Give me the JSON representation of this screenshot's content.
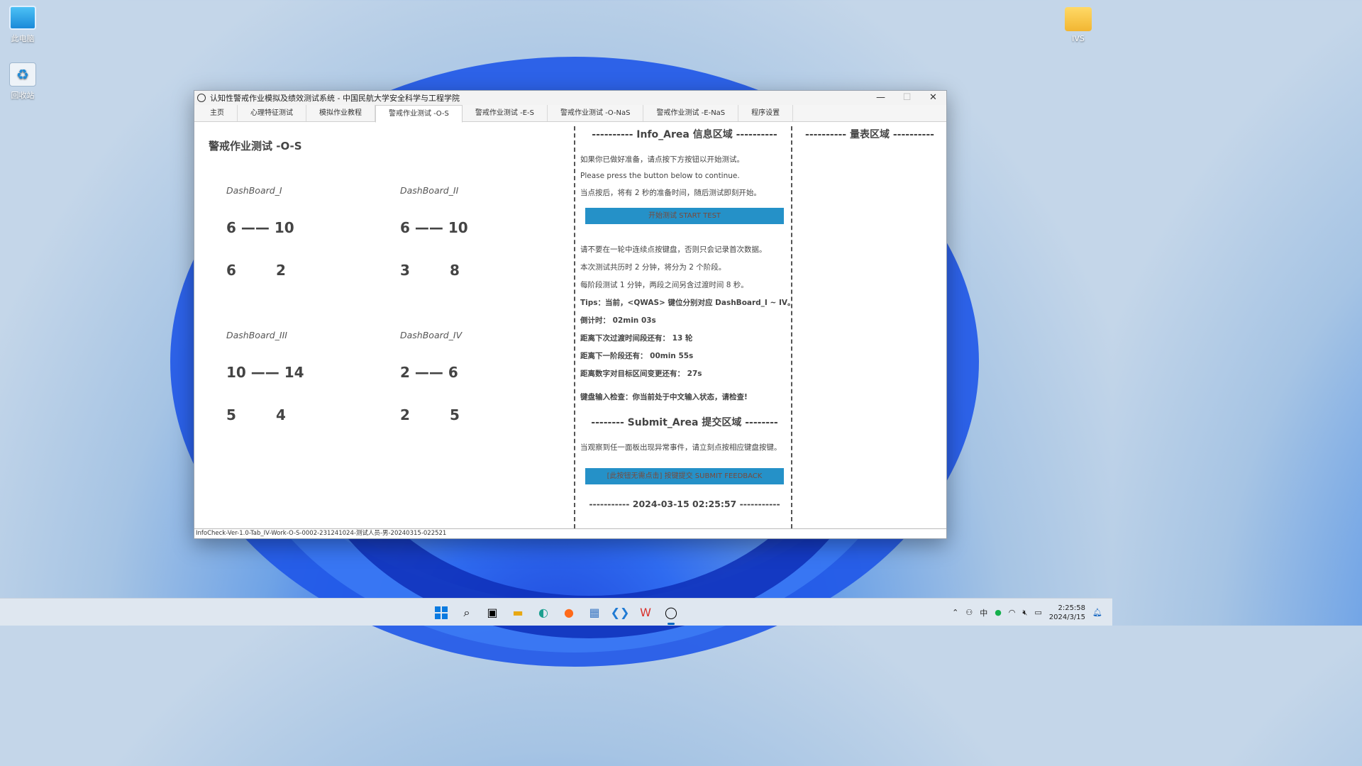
{
  "desktop": {
    "icons": [
      {
        "label": "此电脑"
      },
      {
        "label": "回收站"
      },
      {
        "label": "IVS"
      }
    ]
  },
  "window": {
    "title": "认知性警戒作业模拟及绩效测试系统 - 中国民航大学安全科学与工程学院",
    "controls": {
      "minimize": "—",
      "maximize": "☐",
      "close": "✕"
    }
  },
  "tabs": [
    {
      "label": "主页"
    },
    {
      "label": "心理特征测试"
    },
    {
      "label": "模拟作业教程"
    },
    {
      "label": "警戒作业测试 -O-S",
      "active": true
    },
    {
      "label": "警戒作业测试 -E-S"
    },
    {
      "label": "警戒作业测试 -O-NaS"
    },
    {
      "label": "警戒作业测试 -E-NaS"
    },
    {
      "label": "程序设置"
    }
  ],
  "main": {
    "title": "警戒作业测试 -O-S",
    "dashboards": [
      {
        "name": "DashBoard_I",
        "range": "6 —— 10",
        "a": "6",
        "b": "2"
      },
      {
        "name": "DashBoard_II",
        "range": "6 —— 10",
        "a": "3",
        "b": "8"
      },
      {
        "name": "DashBoard_III",
        "range": "10 —— 14",
        "a": "5",
        "b": "4"
      },
      {
        "name": "DashBoard_IV",
        "range": "2 —— 6",
        "a": "2",
        "b": "5"
      }
    ]
  },
  "info": {
    "header": "---------- Info_Area  信息区域 ----------",
    "lines_top": [
      "如果你已做好准备，请点按下方按钮以开始测试。",
      "Please press the button below to continue.",
      "当点按后，将有 2 秒的准备时间，随后测试即刻开始。"
    ],
    "start_button": "开始测试  START TEST",
    "lines_mid": [
      "请不要在一轮中连续点按键盘，否则只会记录首次数据。",
      "本次测试共历时 2 分钟，将分为 2 个阶段。",
      "每阶段测试 1 分钟，两段之间另含过渡时间 8 秒。"
    ],
    "tips": "Tips：当前，<QWAS> 键位分别对应 DashBoard_I ~ IV。",
    "countdown": "倒计时：  02min 03s",
    "next_transition": "距离下次过渡时间段还有：  13 轮",
    "next_stage": "距离下一阶段还有：  00min 55s",
    "next_interval": "距离数字对目标区间变更还有：  27s",
    "keyboard_check": "键盘输入检查：你当前处于中文输入状态，请检查!",
    "submit_header": "-------- Submit_Area  提交区域 --------",
    "submit_hint": "当观察到任一面板出现异常事件，请立刻点按相应键盘按键。",
    "submit_button": "[此按钮无需点击] 按键提交  SUBMIT FEEDBACK",
    "datetime": "----------- 2024-03-15 02:25:57 -----------"
  },
  "scale": {
    "header": "---------- 量表区域 ----------"
  },
  "status": {
    "text": "InfoCheck-Ver-1.0-Tab_IV-Work-O-S-0002-231241024-测试人员-男-20240315-022521"
  },
  "taskbar": {
    "apps": [
      {
        "icon": "windows-start-icon"
      },
      {
        "icon": "search-icon"
      },
      {
        "icon": "task-view-icon"
      },
      {
        "icon": "file-explorer-icon"
      },
      {
        "icon": "edge-icon"
      },
      {
        "icon": "firefox-icon"
      },
      {
        "icon": "photos-icon"
      },
      {
        "icon": "vscode-icon"
      },
      {
        "icon": "wps-icon"
      },
      {
        "icon": "app-icon",
        "active": true
      }
    ],
    "tray": {
      "ime": "中",
      "time": "2:25:58",
      "date": "2024/3/15"
    }
  },
  "colors": {
    "accent_button": "#2591c8",
    "taskbar_bg": "#dfe7f0"
  }
}
